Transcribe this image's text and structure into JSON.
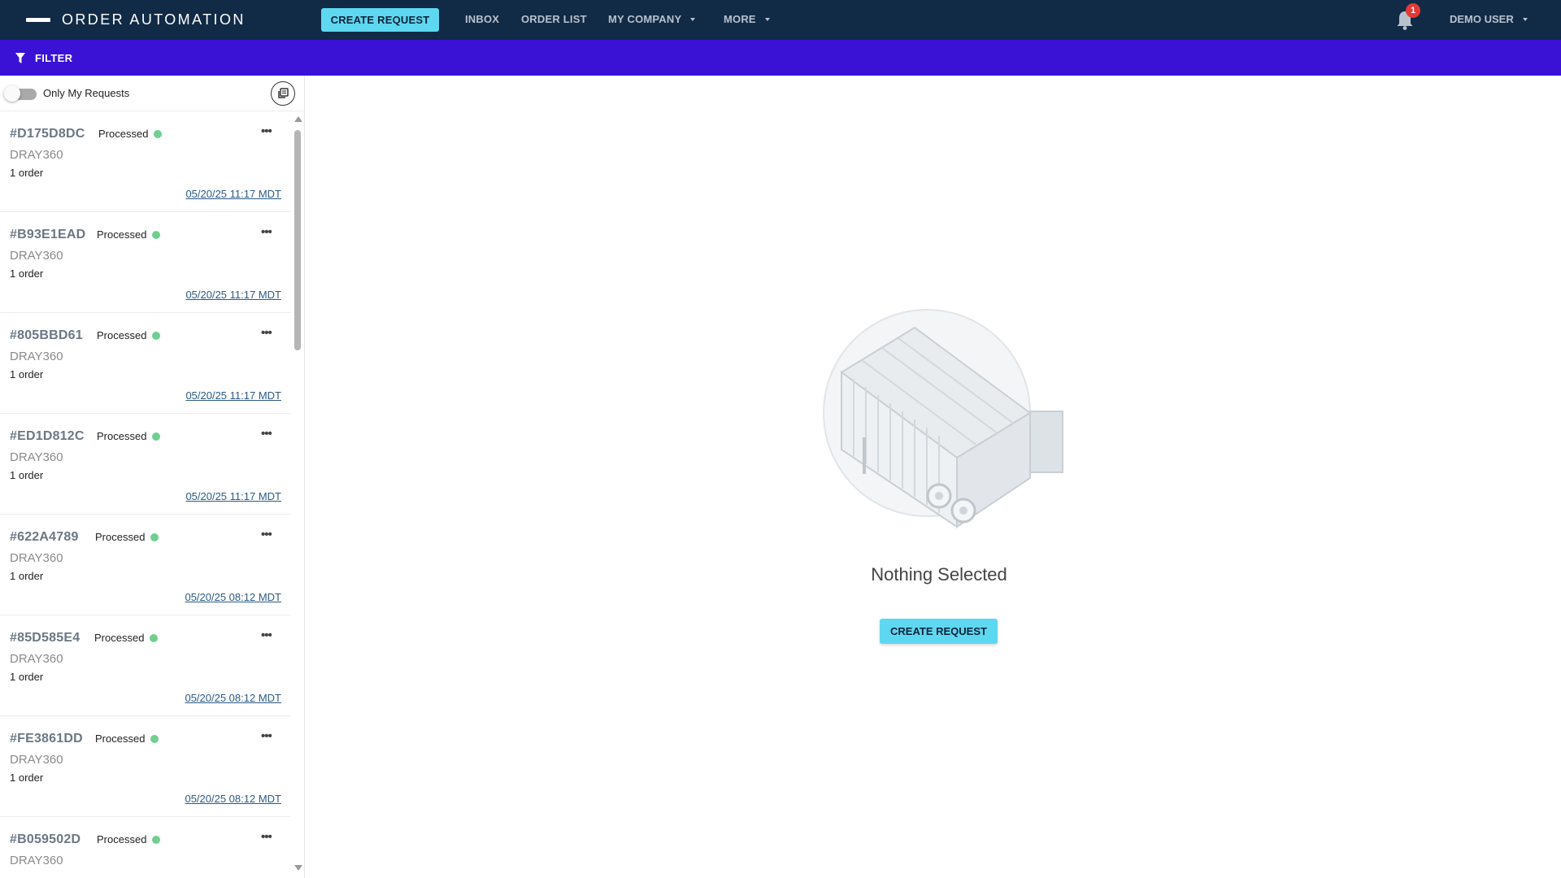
{
  "nav": {
    "brand": "ORDER AUTOMATION",
    "create_request": "CREATE REQUEST",
    "inbox": "INBOX",
    "order_list": "ORDER LIST",
    "my_company": "MY COMPANY",
    "more": "MORE",
    "notification_count": "1",
    "user": "DEMO USER"
  },
  "filter": {
    "label": "FILTER"
  },
  "sidebar": {
    "toggle_label": "Only My Requests",
    "toggle_on": false,
    "requests": [
      {
        "id": "#D175D8DC",
        "status": "Processed",
        "company": "DRAY360",
        "orders": "1 order",
        "date": "05/20/25 11:17 MDT"
      },
      {
        "id": "#B93E1EAD",
        "status": "Processed",
        "company": "DRAY360",
        "orders": "1 order",
        "date": "05/20/25 11:17 MDT"
      },
      {
        "id": "#805BBD61",
        "status": "Processed",
        "company": "DRAY360",
        "orders": "1 order",
        "date": "05/20/25 11:17 MDT"
      },
      {
        "id": "#ED1D812C",
        "status": "Processed",
        "company": "DRAY360",
        "orders": "1 order",
        "date": "05/20/25 11:17 MDT"
      },
      {
        "id": "#622A4789",
        "status": "Processed",
        "company": "DRAY360",
        "orders": "1 order",
        "date": "05/20/25 08:12 MDT"
      },
      {
        "id": "#85D585E4",
        "status": "Processed",
        "company": "DRAY360",
        "orders": "1 order",
        "date": "05/20/25 08:12 MDT"
      },
      {
        "id": "#FE3861DD",
        "status": "Processed",
        "company": "DRAY360",
        "orders": "1 order",
        "date": "05/20/25 08:12 MDT"
      },
      {
        "id": "#B059502D",
        "status": "Processed",
        "company": "DRAY360",
        "orders": "",
        "date": ""
      }
    ]
  },
  "main": {
    "empty_title": "Nothing Selected",
    "create_request": "CREATE REQUEST"
  },
  "colors": {
    "nav_bg": "#112a46",
    "filter_bg": "#3a12d6",
    "accent": "#5ed8f0",
    "status_processed": "#6fcf8f",
    "badge": "#e53935"
  },
  "icons": [
    "menu-bar-icon",
    "caret-down-icon",
    "bell-icon",
    "filter-icon",
    "copy-icon",
    "more-dots-icon",
    "truck-trailer-illustration"
  ]
}
